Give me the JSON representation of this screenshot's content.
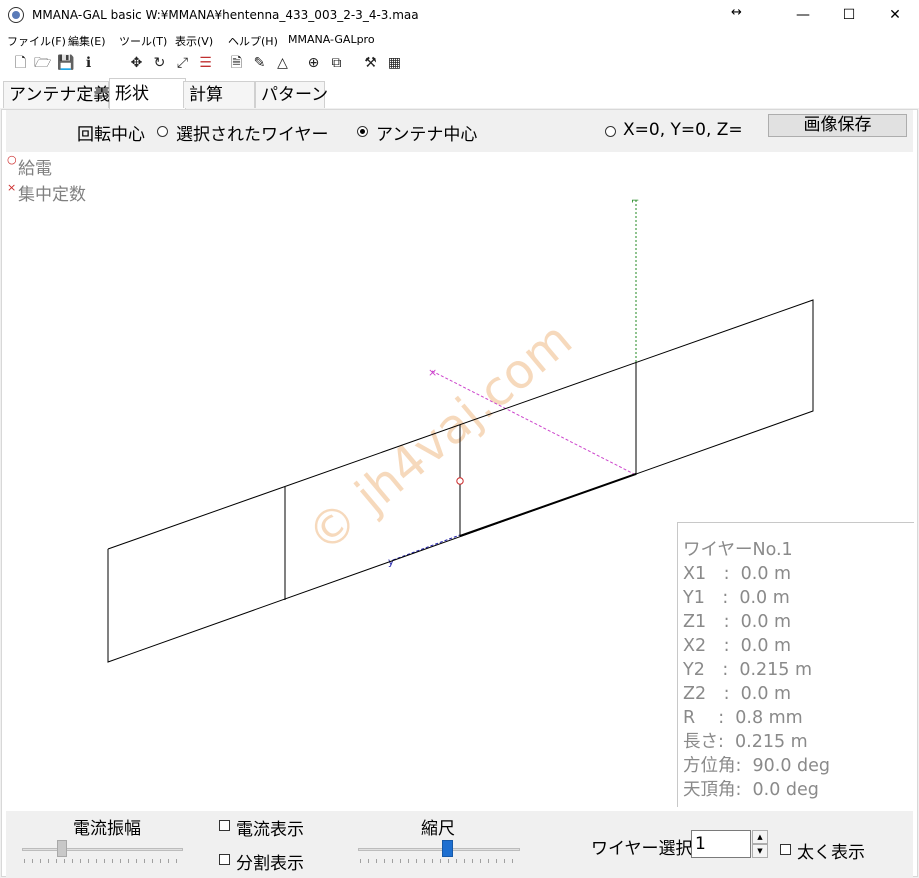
{
  "window": {
    "title": "MMANA-GAL basic W:¥MMANA¥hentenna_433_003_2-3_4-3.maa",
    "resize_glyph": "↔",
    "minimize": "—",
    "maximize": "☐",
    "close": "✕"
  },
  "menu": {
    "items": [
      "ファイル(F)",
      "編集(E)",
      "ツール(T)",
      "表示(V)",
      "ヘルプ(H)",
      "MMANA-GALpro"
    ]
  },
  "toolbar": {
    "icons": [
      "new-file-icon",
      "open-folder-icon",
      "save-disk-icon",
      "info-icon",
      "move-icon",
      "rotate-icon",
      "resize-icon",
      "segments-icon",
      "document-icon",
      "pen-icon",
      "triangle-icon",
      "crosshair-icon",
      "copy-icon",
      "tools-icon",
      "calculator-icon"
    ],
    "glyphs": [
      "🗋",
      "🗁",
      "💾",
      "ℹ",
      "✥",
      "↻",
      "⤢",
      "☰",
      "🗎",
      "✎",
      "△",
      "⊕",
      "⧉",
      "⚒",
      "▦"
    ]
  },
  "tabs": [
    "アンテナ定義",
    "形状",
    "計算",
    "パターン"
  ],
  "active_tab": 1,
  "rotation": {
    "label": "回転中心",
    "options": [
      "選択されたワイヤー",
      "アンテナ中心",
      "X=0, Y=0, Z="
    ],
    "selected": 1
  },
  "save_image_button": "画像保存",
  "legend": {
    "feed_marker": "○",
    "feed_label": "給電",
    "load_marker": "×",
    "load_label": "集中定数"
  },
  "watermark": "© jh4vaj.com",
  "wire_info": {
    "title": "ワイヤーNo.1",
    "lines": [
      "X1　:  0.0 m",
      "Y1　:  0.0 m",
      "Z1　:  0.0 m",
      "X2　:  0.0 m",
      "Y2　:  0.215 m",
      "Z2　:  0.0 m",
      "R　 :  0.8 mm",
      "長さ:  0.215 m",
      "方位角:  90.0 deg",
      "天頂角:  0.0 deg"
    ]
  },
  "bottom": {
    "current_amplitude_label": "電流振幅",
    "current_amplitude_level": 0.25,
    "scale_label": "縮尺",
    "scale_level": 0.55,
    "show_current_label": "電流表示",
    "show_current_checked": false,
    "show_segments_label": "分割表示",
    "show_segments_checked": false,
    "wire_select_label": "ワイヤー選択",
    "wire_select_value": "1",
    "bold_display_label": "太く表示",
    "bold_display_checked": false
  },
  "colors": {
    "feed": "#cc2a2a",
    "load": "#cc2a2a",
    "axis_x": "#cc44cc",
    "axis_y": "#2020aa",
    "axis_z": "#228822",
    "slider_thumb_active": "#1e6fd0",
    "watermark": "#f3c9a0"
  }
}
